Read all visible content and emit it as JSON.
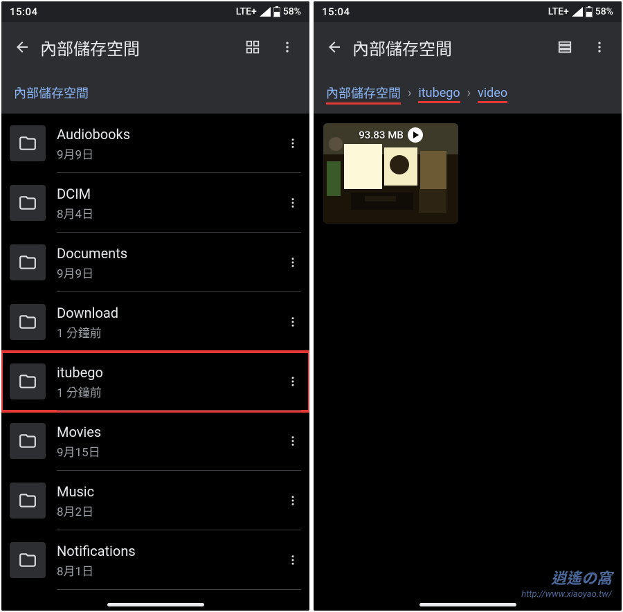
{
  "status": {
    "time": "15:04",
    "network": "LTE+",
    "battery": "58%"
  },
  "left": {
    "title": "內部儲存空間",
    "breadcrumb_root": "內部儲存空間",
    "folders": [
      {
        "name": "Audiobooks",
        "sub": "9月9日",
        "hl": false
      },
      {
        "name": "DCIM",
        "sub": "8月4日",
        "hl": false
      },
      {
        "name": "Documents",
        "sub": "9月9日",
        "hl": false
      },
      {
        "name": "Download",
        "sub": "1 分鐘前",
        "hl": false
      },
      {
        "name": "itubego",
        "sub": "1 分鐘前",
        "hl": true
      },
      {
        "name": "Movies",
        "sub": "9月15日",
        "hl": false
      },
      {
        "name": "Music",
        "sub": "8月2日",
        "hl": false
      },
      {
        "name": "Notifications",
        "sub": "8月1日",
        "hl": false
      }
    ]
  },
  "right": {
    "title": "內部儲存空間",
    "breadcrumb": [
      "內部儲存空間",
      "itubego",
      "video"
    ],
    "video": {
      "size": "93.83 MB"
    }
  },
  "watermark": {
    "l1": "逍遙の窩",
    "l2": "http://www.xiaoyao.tw/"
  }
}
